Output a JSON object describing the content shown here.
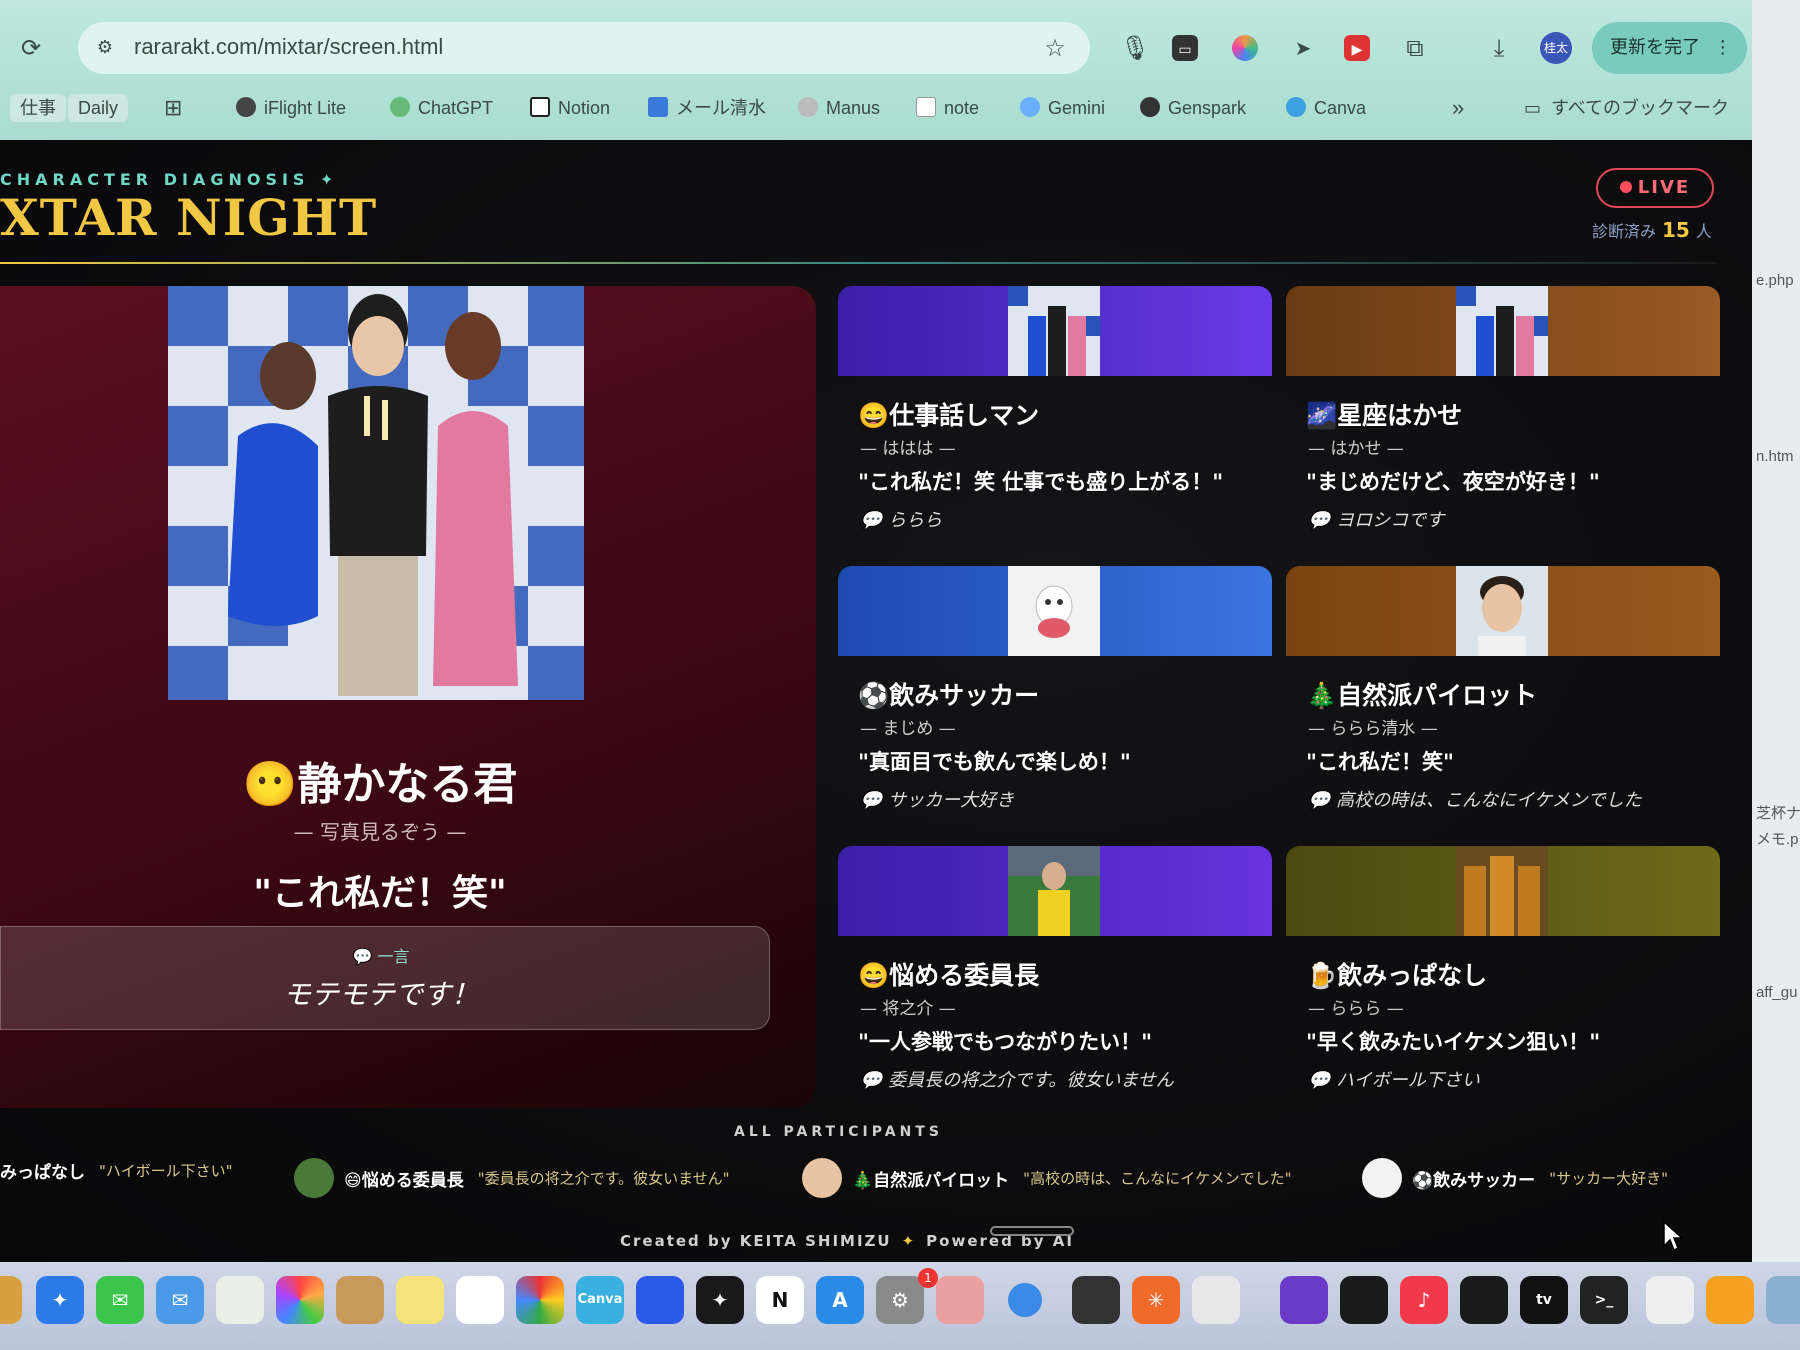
{
  "browser": {
    "url": "rararakt.com/mixtar/screen.html",
    "update_button": "更新を完了",
    "profile_badge": "桂太",
    "icons": [
      "reload-icon",
      "site-info-icon",
      "star-icon",
      "mic-icon",
      "cast-icon",
      "colorwheel-icon",
      "send-icon",
      "video-icon",
      "extensions-icon",
      "download-icon",
      "menu-dots-icon"
    ],
    "bookmarks": [
      "仕事",
      "Daily",
      "iFlight Lite",
      "ChatGPT",
      "Notion",
      "メール清水",
      "Manus",
      "note",
      "Gemini",
      "Genspark",
      "Canva"
    ],
    "bookmarks_more": "»",
    "all_bookmarks": "すべてのブックマーク"
  },
  "header": {
    "subtitle": "CHARACTER DIAGNOSIS ✦",
    "title": "XTAR NIGHT",
    "live_label": "LIVE",
    "count_prefix": "診断済み",
    "count_value": "15",
    "count_suffix": "人"
  },
  "featured": {
    "emoji": "😶",
    "name": "静かなる君",
    "subtitle": "— 写真見るぞう —",
    "quote": "\"これ私だ！笑\"",
    "comment_label": "💬 一言",
    "comment": "モテモテです！"
  },
  "cards": [
    {
      "name": "😄仕事話しマン",
      "sub": "— ははは —",
      "quote": "\"これ私だ！笑 仕事でも盛り上がる！\"",
      "comment": "💬 ららら",
      "color": "#5b2fd6"
    },
    {
      "name": "🌌星座はかせ",
      "sub": "— はかせ —",
      "quote": "\"まじめだけど、夜空が好き！\"",
      "comment": "💬 ヨロシコです",
      "color": "#7a4a1e"
    },
    {
      "name": "⚽飲みサッカー",
      "sub": "— まじめ —",
      "quote": "\"真面目でも飲んで楽しめ！\"",
      "comment": "💬 サッカー大好き",
      "color": "#2a62cf"
    },
    {
      "name": "🎄自然派パイロット",
      "sub": "— ららら清水 —",
      "quote": "\"これ私だ！笑\"",
      "comment": "💬 高校の時は、こんなにイケメンでした",
      "color": "#8a4f1a"
    },
    {
      "name": "😄悩める委員長",
      "sub": "— 将之介 —",
      "quote": "\"一人参戦でもつながりたい！\"",
      "comment": "💬 委員長の将之介です。彼女いません",
      "color": "#5a28c8"
    },
    {
      "name": "🍺飲みっぱなし",
      "sub": "— ららら —",
      "quote": "\"早く飲みたいイケメン狙い！\"",
      "comment": "💬 ハイボール下さい",
      "color": "#5a5a14"
    }
  ],
  "participants_label": "ALL PARTICIPANTS",
  "participants": [
    {
      "name": "みっぱなし",
      "comment": "\"ハイボール下さい\""
    },
    {
      "name": "😄悩める委員長",
      "comment": "\"委員長の将之介です。彼女いません\""
    },
    {
      "name": "🎄自然派パイロット",
      "comment": "\"高校の時は、こんなにイケメンでした\""
    },
    {
      "name": "⚽飲みサッカー",
      "comment": "\"サッカー大好き\""
    }
  ],
  "footer": {
    "created": "Created by KEITA SHIMIZU",
    "sep": "✦",
    "powered": "Powered by AI"
  },
  "side_window": [
    "e.php",
    "n.htm",
    "芝杯ナ",
    "メモ.p",
    "aff_gu"
  ],
  "dock_badge": "1"
}
